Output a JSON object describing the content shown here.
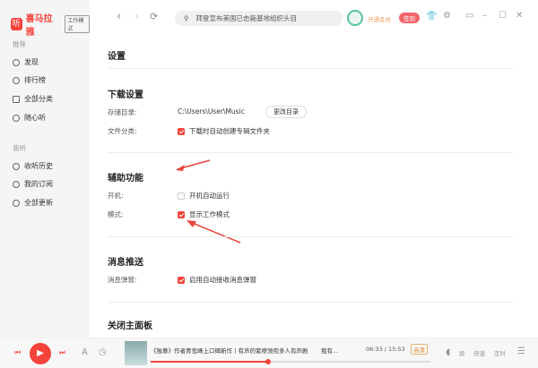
{
  "app": {
    "logo_text": "喜马拉雅",
    "logo_glyph": "听",
    "mode_badge": "工作模式"
  },
  "sidebar": {
    "section1": "推荐",
    "items1": [
      "发现",
      "排行榜",
      "全部分类",
      "随心听"
    ],
    "section2": "我听",
    "items2": [
      "收听历史",
      "我的订阅",
      "全部更新"
    ]
  },
  "topbar": {
    "search_text": "拜登宣布美国已击毙基地组织头目",
    "vip": "开通会员",
    "signin": "签到"
  },
  "settings": {
    "title": "设置",
    "download": {
      "heading": "下载设置",
      "storage_label": "存储目录:",
      "storage_path": "C:\\Users\\User\\Music",
      "change_button": "更改目录",
      "category_label": "文件分类:",
      "category_option": "下载时自动创建专辑文件夹"
    },
    "accessibility": {
      "heading": "辅助功能",
      "boot_label": "开机:",
      "boot_option": "开机自动运行",
      "mode_label": "模式:",
      "mode_option": "显示工作模式"
    },
    "push": {
      "heading": "消息推送",
      "popup_label": "消息弹窗:",
      "popup_option": "启用自动接收消息弹窗"
    },
    "close": {
      "heading": "关闭主面板"
    }
  },
  "player": {
    "track_title": "《独尊》作者青鸾峰上口碑新作丨有声的紫襟领衔多人有声剧",
    "track_suffix": "我有...",
    "time": "06:33 / 15:53",
    "progress": 0.42,
    "quality": "高清",
    "jump": "跳",
    "speed": "倍速",
    "timer": "定时"
  },
  "colors": {
    "accent": "#f4433a"
  }
}
